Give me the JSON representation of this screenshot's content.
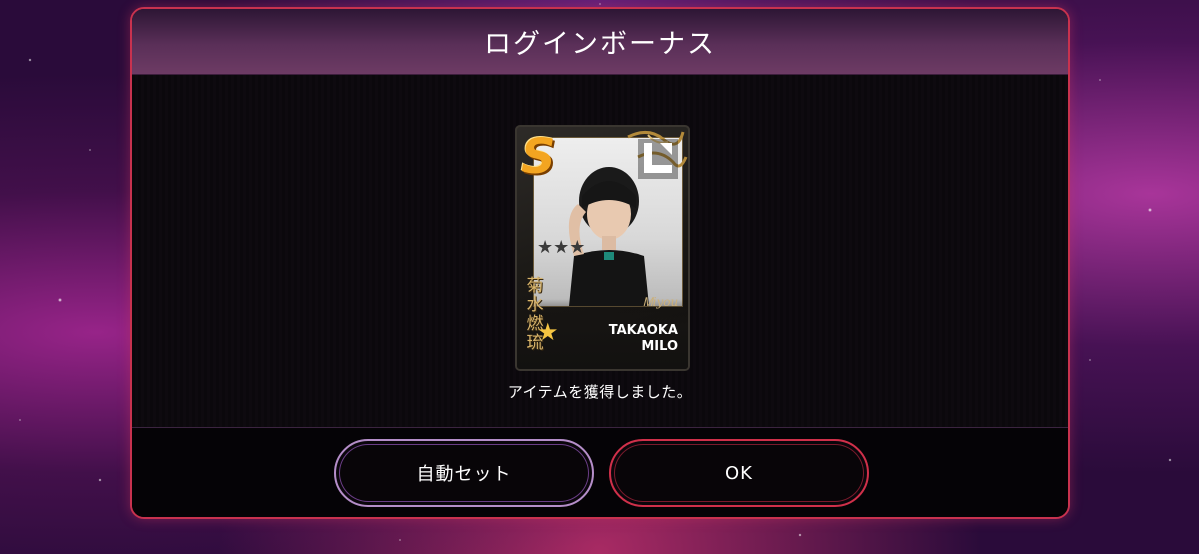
{
  "dialog": {
    "title": "ログインボーナス",
    "message": "アイテムを獲得しました。"
  },
  "card": {
    "rarity": "S",
    "name_line1": "TAKAOKA",
    "name_line2": "MILO",
    "kanji": "菊水燃琉",
    "signature": "Ꮇiyou",
    "star": "★",
    "dim_stars": "★★★",
    "logo_icon": "label-logo-icon"
  },
  "buttons": {
    "auto_set": "自動セット",
    "ok": "OK"
  },
  "colors": {
    "dialog_border": "#c8324f",
    "auto_button_border": "#b58ec9",
    "ok_button_border": "#d0304a",
    "rarity_gold": "#f3a521"
  }
}
